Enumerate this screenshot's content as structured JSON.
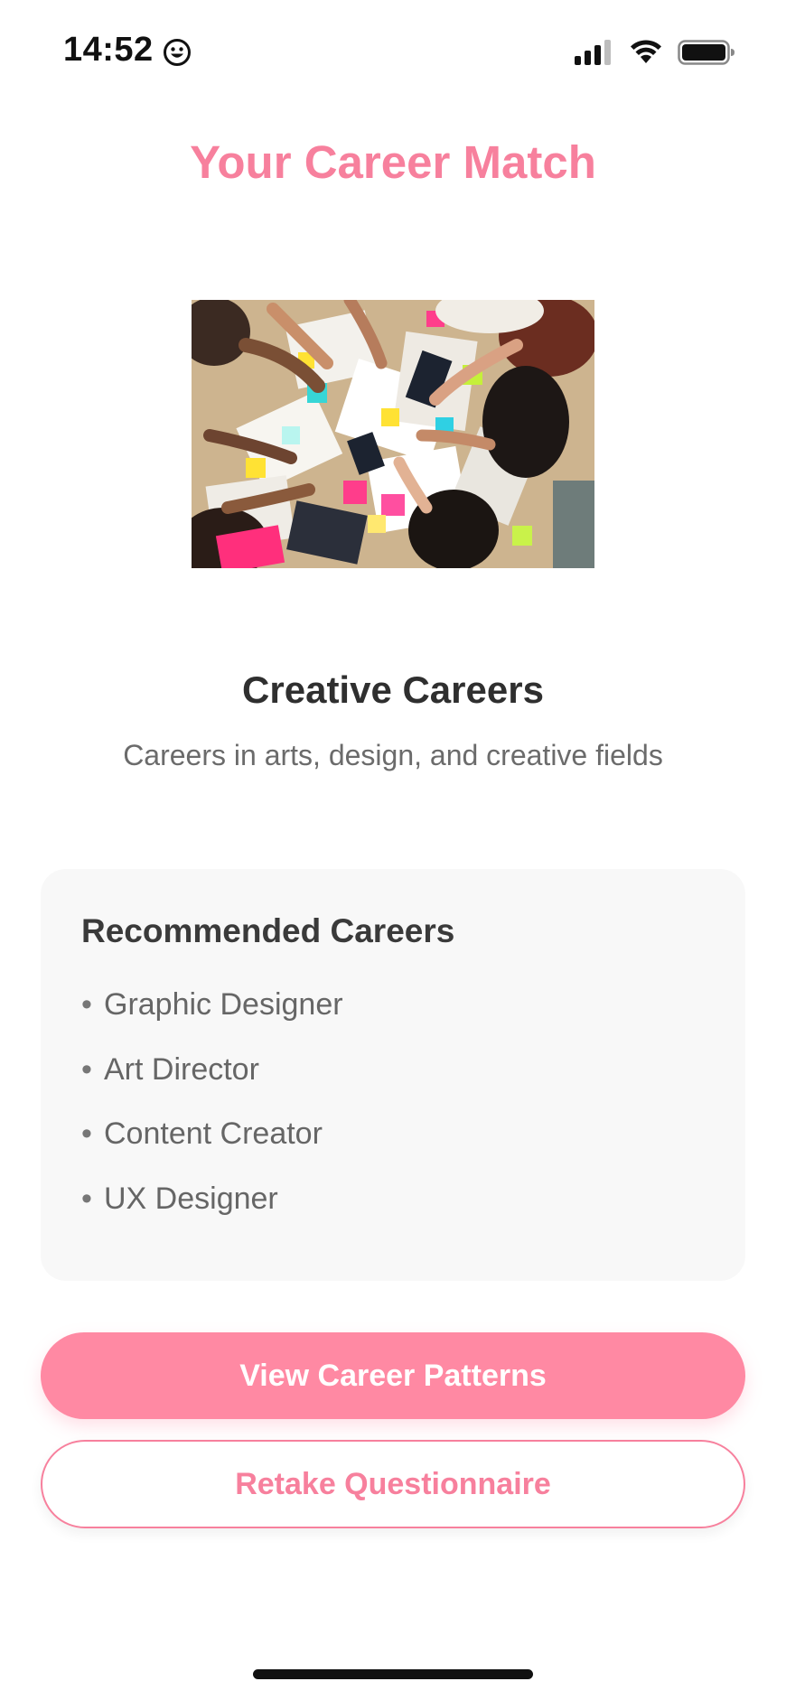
{
  "status_bar": {
    "time": "14:52",
    "icons": [
      "smiley-icon",
      "signal-icon",
      "wifi-icon",
      "battery-icon"
    ]
  },
  "header": {
    "title": "Your Career Match"
  },
  "result": {
    "image_icon": "creative-team-photo",
    "title": "Creative Careers",
    "description": "Careers in arts, design, and creative fields"
  },
  "recommended": {
    "title": "Recommended Careers",
    "bullet": "•",
    "items": [
      "Graphic Designer",
      "Art Director",
      "Content Creator",
      "UX Designer"
    ]
  },
  "buttons": {
    "primary_label": "View Career Patterns",
    "secondary_label": "Retake Questionnaire"
  },
  "colors": {
    "accent": "#F7809D",
    "button_fill": "#FF89A3",
    "card_bg": "#F8F8F8"
  }
}
